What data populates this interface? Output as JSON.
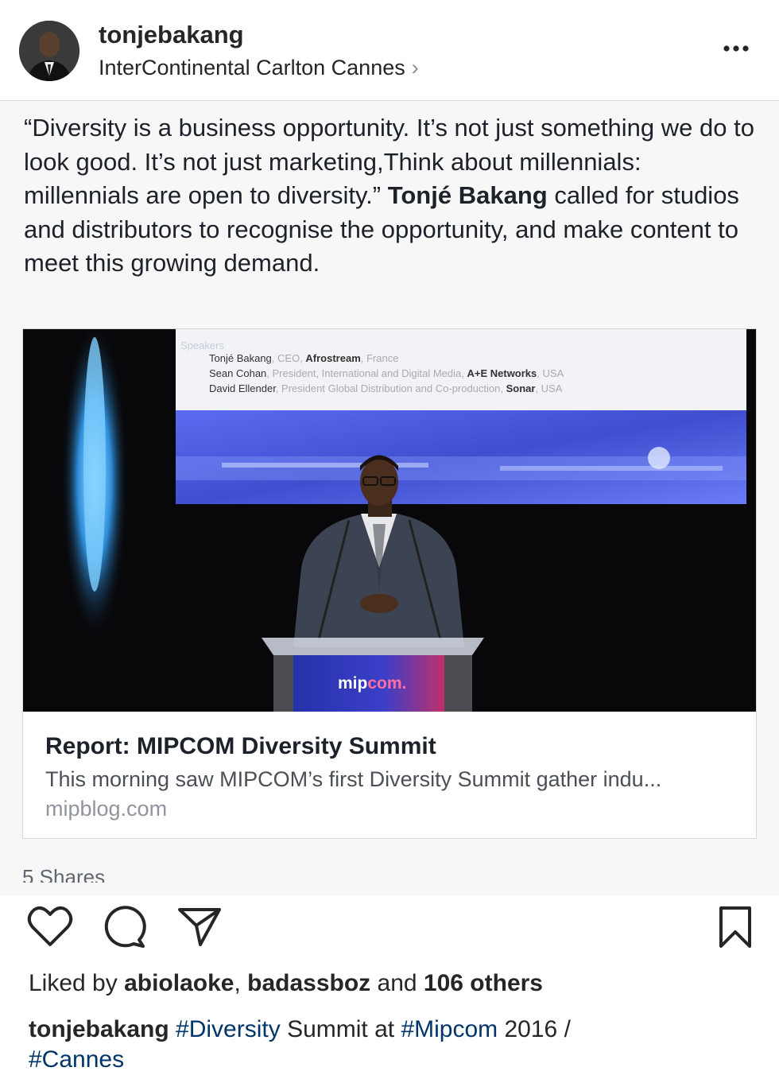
{
  "header": {
    "username": "tonjebakang",
    "location": "InterContinental Carlton Cannes",
    "location_chevron": "›"
  },
  "shared_post": {
    "quote_text": "“Diversity is a business opportunity. It’s not just something we do to look good. It’s not just marketing,Think about millennials: millennials are open to diversity.” ",
    "quote_name": "Tonjé Bakang",
    "quote_rest": " called for studios and distributors to recognise the opportunity, and make content to meet this growing demand.",
    "link": {
      "screen_heading": "Speakers",
      "speakers": [
        {
          "name": "Tonjé Bakang",
          "role": ", CEO, ",
          "org": "Afrostream",
          "country": ", France"
        },
        {
          "name": "Sean Cohan",
          "role": ", President, International and Digital Media, ",
          "org": "A+E Networks",
          "country": ", USA"
        },
        {
          "name": "David Ellender",
          "role": ", President Global Distribution and Co-production, ",
          "org": "Sonar",
          "country": ", USA"
        }
      ],
      "podium_logo_a": "mip",
      "podium_logo_b": "com.",
      "title": "Report: MIPCOM Diversity Summit",
      "description": "This morning saw MIPCOM’s first Diversity Summit gather indu...",
      "domain": "mipblog.com"
    },
    "shares": "5 Shares"
  },
  "actions": {
    "like_icon": "heart-icon",
    "comment_icon": "comment-icon",
    "share_icon": "paper-plane-icon",
    "save_icon": "bookmark-icon"
  },
  "likes": {
    "prefix": "Liked by ",
    "user1": "abiolaoke",
    "sep": ", ",
    "user2": "badassboz",
    "and": " and ",
    "others": "106 others"
  },
  "caption": {
    "username": "tonjebakang",
    "tag1": "#Diversity",
    "text1": " Summit at ",
    "tag2": "#Mipcom",
    "text2": " 2016 / ",
    "tag3": "#Cannes"
  },
  "colors": {
    "hashtag": "#003569",
    "text": "#262626",
    "muted": "#8e8e8e",
    "screen_blue": "#4a5fd6"
  }
}
